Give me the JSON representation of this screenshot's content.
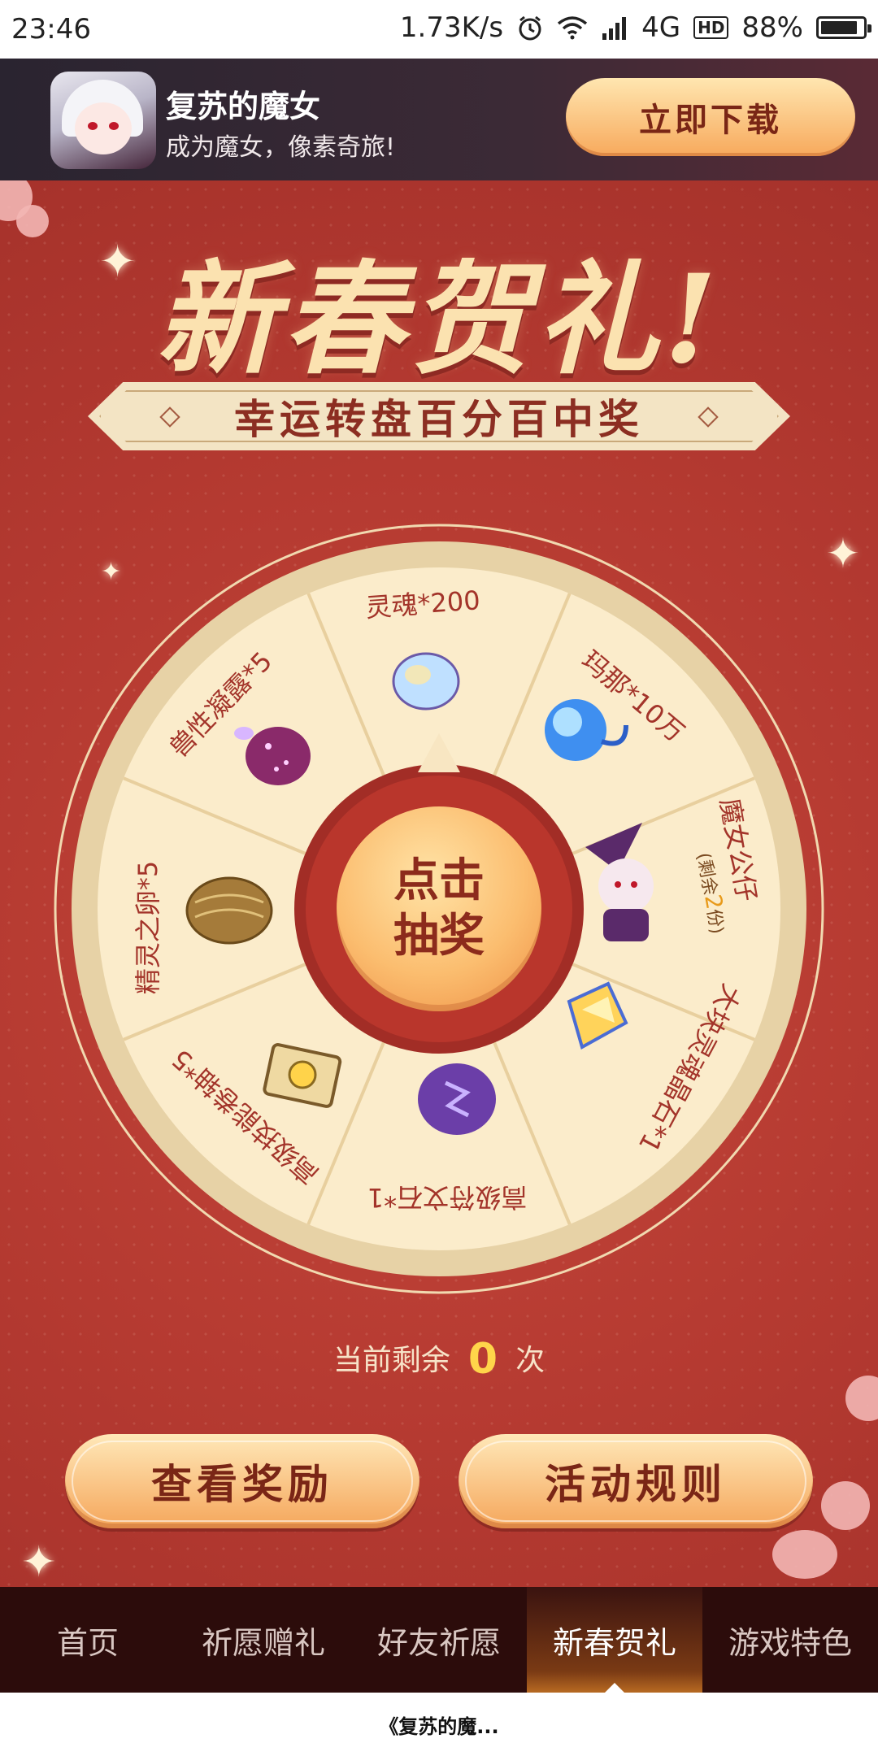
{
  "status_bar": {
    "time": "23:46",
    "speed": "1.73K/s",
    "network": "4G",
    "hd": "HD",
    "battery": "88%",
    "battery_level": 0.88,
    "icons": [
      "alarm-icon",
      "wifi-icon",
      "signal-icon",
      "battery-icon"
    ]
  },
  "banner": {
    "app_name": "复苏的魔女",
    "slogan": "成为魔女，像素奇旅!",
    "download_label": "立即下载"
  },
  "event": {
    "title": "新春贺礼!",
    "subtitle": "幸运转盘百分百中奖"
  },
  "wheel": {
    "center_line1": "点击",
    "center_line2": "抽奖",
    "prizes": [
      {
        "label": "灵魂*200",
        "icon": "soul-gem-icon"
      },
      {
        "label": "玛那*10万",
        "icon": "mana-flame-icon"
      },
      {
        "label": "魔女公仔",
        "sub_prefix": "(剩余",
        "sub_count": "2",
        "sub_suffix": "份)",
        "icon": "witch-doll-icon"
      },
      {
        "label": "大块灵魂晶石*1",
        "icon": "soul-crystal-icon"
      },
      {
        "label": "高级符文石*1",
        "icon": "rune-stone-icon"
      },
      {
        "label": "高级技能卷轴*5",
        "icon": "skill-scroll-icon"
      },
      {
        "label": "精灵之卵*5",
        "icon": "spirit-egg-icon"
      },
      {
        "label": "兽性凝露*5",
        "icon": "beast-dew-icon"
      }
    ]
  },
  "remaining": {
    "prefix": "当前剩余",
    "count": "0",
    "suffix": "次"
  },
  "buttons": {
    "rewards": "查看奖励",
    "rules": "活动规则"
  },
  "tabs": [
    {
      "label": "首页",
      "active": false
    },
    {
      "label": "祈愿赠礼",
      "active": false
    },
    {
      "label": "好友祈愿",
      "active": false
    },
    {
      "label": "新春贺礼",
      "active": true
    },
    {
      "label": "游戏特色",
      "active": false
    }
  ],
  "caption": "《复苏的魔...",
  "colors": {
    "background": "#b53a31",
    "gold": "#fbe2b0",
    "accent_orange": "#f5a65b",
    "count_yellow": "#ffd54a",
    "tabbar": "#2c0c0b"
  }
}
